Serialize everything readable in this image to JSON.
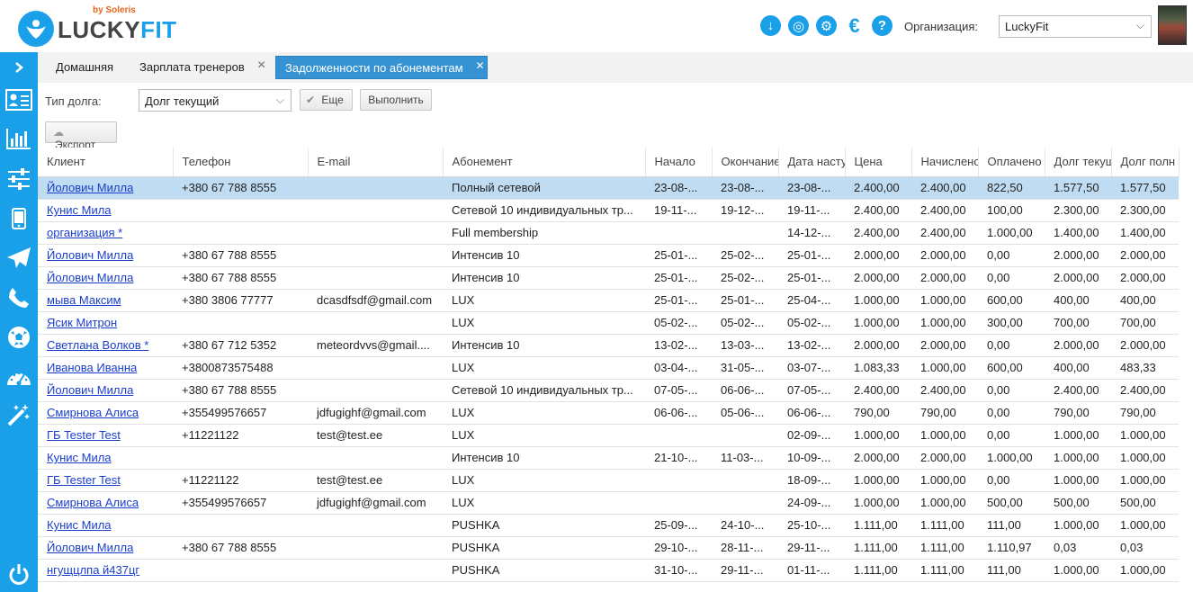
{
  "brand": {
    "name_a": "LUCKY",
    "name_b": "FIT",
    "by": "by Soleris"
  },
  "header": {
    "org_label": "Организация:",
    "org_value": "LuckyFit",
    "icons": [
      "download-icon",
      "lifebuoy-icon",
      "gear-icon",
      "euro-icon",
      "help-icon"
    ]
  },
  "sidebar": {
    "icons": [
      "chevron-right-icon",
      "id-card-icon",
      "bar-chart-icon",
      "sliders-icon",
      "mobile-icon",
      "paper-plane-icon",
      "phone-icon",
      "soccer-ball-icon",
      "dashboard-icon",
      "magic-wand-icon",
      "power-icon"
    ]
  },
  "tabs": [
    {
      "label": "Домашняя",
      "closable": false,
      "active": false
    },
    {
      "label": "Зарплата тренеров",
      "closable": true,
      "active": false
    },
    {
      "label": "Задолженности по абонементам",
      "closable": true,
      "active": true
    }
  ],
  "filters": {
    "debt_type_label": "Тип долга:",
    "debt_type_value": "Долг текущий",
    "more_label": "Еще",
    "run_label": "Выполнить",
    "export_label": "Экспорт"
  },
  "table": {
    "columns": [
      "Клиент",
      "Телефон",
      "E-mail",
      "Абонемент",
      "Начало",
      "Окончание",
      "Дата насту",
      "Цена",
      "Начислено",
      "Оплачено",
      "Долг текущ",
      "Долг полн"
    ],
    "rows": [
      [
        "Йолович Милла",
        "+380 67 788 8555",
        "",
        "Полный сетевой",
        "23-08-...",
        "23-08-...",
        "23-08-...",
        "2.400,00",
        "2.400,00",
        "822,50",
        "1.577,50",
        "1.577,50"
      ],
      [
        "Кунис Мила",
        "",
        "",
        "Сетевой 10 индивидуальных тр...",
        "19-11-...",
        "19-12-...",
        "19-11-...",
        "2.400,00",
        "2.400,00",
        "100,00",
        "2.300,00",
        "2.300,00"
      ],
      [
        "организация *",
        "",
        "",
        "Full membership",
        "",
        "",
        "14-12-...",
        "2.400,00",
        "2.400,00",
        "1.000,00",
        "1.400,00",
        "1.400,00"
      ],
      [
        "Йолович Милла",
        "+380 67 788 8555",
        "",
        "Интенсив 10",
        "25-01-...",
        "25-02-...",
        "25-01-...",
        "2.000,00",
        "2.000,00",
        "0,00",
        "2.000,00",
        "2.000,00"
      ],
      [
        "Йолович Милла",
        "+380 67 788 8555",
        "",
        "Интенсив 10",
        "25-01-...",
        "25-02-...",
        "25-01-...",
        "2.000,00",
        "2.000,00",
        "0,00",
        "2.000,00",
        "2.000,00"
      ],
      [
        "мыва Максим",
        "+380 3806 77777",
        "dcasdfsdf@gmail.com",
        "LUX",
        "25-01-...",
        "25-01-...",
        "25-04-...",
        "1.000,00",
        "1.000,00",
        "600,00",
        "400,00",
        "400,00"
      ],
      [
        "Ясик Митрон",
        "",
        "",
        "LUX",
        "05-02-...",
        "05-02-...",
        "05-02-...",
        "1.000,00",
        "1.000,00",
        "300,00",
        "700,00",
        "700,00"
      ],
      [
        "Светлана Волков *",
        "+380 67 712 5352",
        "meteordvvs@gmail....",
        "Интенсив 10",
        "13-02-...",
        "13-03-...",
        "13-02-...",
        "2.000,00",
        "2.000,00",
        "0,00",
        "2.000,00",
        "2.000,00"
      ],
      [
        "Иванова Иванна",
        "+3800873575488",
        "",
        "LUX",
        "03-04-...",
        "31-05-...",
        "03-07-...",
        "1.083,33",
        "1.000,00",
        "600,00",
        "400,00",
        "483,33"
      ],
      [
        "Йолович Милла",
        "+380 67 788 8555",
        "",
        "Сетевой 10 индивидуальных тр...",
        "07-05-...",
        "06-06-...",
        "07-05-...",
        "2.400,00",
        "2.400,00",
        "0,00",
        "2.400,00",
        "2.400,00"
      ],
      [
        "Смирнова Алиса",
        "+355499576657",
        "jdfugighf@gmail.com",
        "LUX",
        "06-06-...",
        "05-06-...",
        "06-06-...",
        "790,00",
        "790,00",
        "0,00",
        "790,00",
        "790,00"
      ],
      [
        "ГБ Tester Test",
        "+11221122",
        "test@test.ee",
        "LUX",
        "",
        "",
        "02-09-...",
        "1.000,00",
        "1.000,00",
        "0,00",
        "1.000,00",
        "1.000,00"
      ],
      [
        "Кунис Мила",
        "",
        "",
        "Интенсив 10",
        "21-10-...",
        "11-03-...",
        "10-09-...",
        "2.000,00",
        "2.000,00",
        "1.000,00",
        "1.000,00",
        "1.000,00"
      ],
      [
        "ГБ Tester Test",
        "+11221122",
        "test@test.ee",
        "LUX",
        "",
        "",
        "18-09-...",
        "1.000,00",
        "1.000,00",
        "0,00",
        "1.000,00",
        "1.000,00"
      ],
      [
        "Смирнова Алиса",
        "+355499576657",
        "jdfugighf@gmail.com",
        "LUX",
        "",
        "",
        "24-09-...",
        "1.000,00",
        "1.000,00",
        "500,00",
        "500,00",
        "500,00"
      ],
      [
        "Кунис Мила",
        "",
        "",
        "PUSHKA",
        "25-09-...",
        "24-10-...",
        "25-10-...",
        "1.111,00",
        "1.111,00",
        "111,00",
        "1.000,00",
        "1.000,00"
      ],
      [
        "Йолович Милла",
        "+380 67 788 8555",
        "",
        "PUSHKA",
        "29-10-...",
        "28-11-...",
        "29-11-...",
        "1.111,00",
        "1.111,00",
        "1.110,97",
        "0,03",
        "0,03"
      ],
      [
        "нгущцлпа й437цг",
        "",
        "",
        "PUSHKA",
        "31-10-...",
        "29-11-...",
        "01-11-...",
        "1.111,00",
        "1.111,00",
        "111,00",
        "1.000,00",
        "1.000,00"
      ]
    ]
  }
}
